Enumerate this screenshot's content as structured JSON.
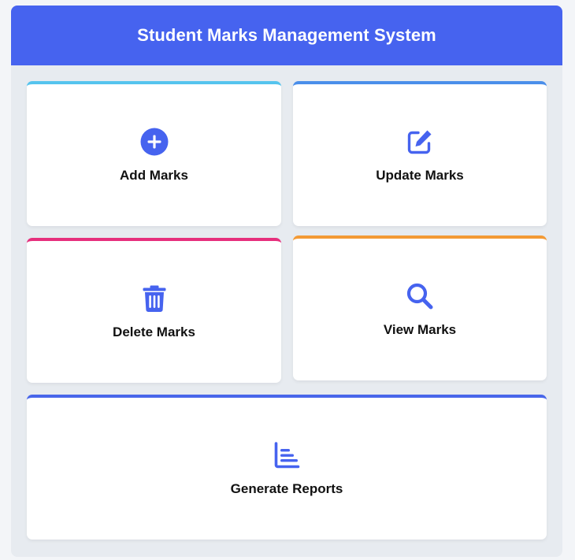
{
  "app": {
    "title": "Student Marks Management System"
  },
  "colors": {
    "header": "#4663ef",
    "icon": "#4663ef",
    "add_accent": "#55c4ee",
    "update_accent": "#4a8eea",
    "delete_accent": "#e62f7d",
    "view_accent": "#f39a35",
    "reports_accent": "#4866ea"
  },
  "cards": {
    "add": {
      "label": "Add Marks",
      "icon": "plus-circle-icon"
    },
    "update": {
      "label": "Update Marks",
      "icon": "edit-icon"
    },
    "delete": {
      "label": "Delete Marks",
      "icon": "trash-icon"
    },
    "view": {
      "label": "View Marks",
      "icon": "search-icon"
    },
    "reports": {
      "label": "Generate Reports",
      "icon": "bar-chart-icon"
    }
  }
}
